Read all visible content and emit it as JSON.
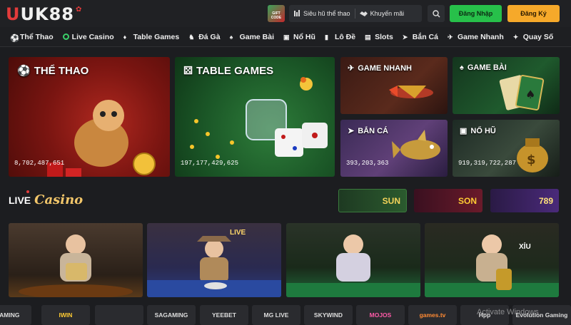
{
  "header": {
    "logo_text": "UK88",
    "gift_label": "GIFT CODE",
    "top_links": [
      {
        "label": "Siêu hũ thể thao",
        "icon": "sliders-icon"
      },
      {
        "label": "Khuyến mãi",
        "icon": "handshake-icon"
      }
    ],
    "login_label": "Đăng Nhập",
    "register_label": "Đăng Ký"
  },
  "nav": [
    {
      "label": "Thể Thao",
      "icon": "sports-icon"
    },
    {
      "label": "Live Casino",
      "icon": "casino-chip-icon"
    },
    {
      "label": "Table Games",
      "icon": "table-games-icon"
    },
    {
      "label": "Đá Gà",
      "icon": "rooster-icon"
    },
    {
      "label": "Game Bài",
      "icon": "cards-icon"
    },
    {
      "label": "Nổ Hũ",
      "icon": "jar-icon"
    },
    {
      "label": "Lô Đề",
      "icon": "lottery-icon"
    },
    {
      "label": "Slots",
      "icon": "slot-machine-icon"
    },
    {
      "label": "Bắn Cá",
      "icon": "fish-icon"
    },
    {
      "label": "Game Nhanh",
      "icon": "rocket-icon"
    },
    {
      "label": "Quay Số",
      "icon": "wheel-icon"
    }
  ],
  "tiles": {
    "thethao": {
      "title": "THỂ THAO",
      "count": "8,702,487,651"
    },
    "table": {
      "title": "TABLE GAMES",
      "count": "197,177,429,625"
    },
    "nhanh": {
      "title": "GAME NHANH"
    },
    "bai": {
      "title": "GAME BÀI"
    },
    "ca": {
      "title": "BẮN CÁ",
      "count": "393,203,363"
    },
    "hu": {
      "title": "NỔ HŨ",
      "count": "919,319,722,287"
    }
  },
  "live": {
    "title_prefix": "LIVE",
    "title_script": "Casino",
    "brands": [
      "SUN",
      "SON",
      "789"
    ],
    "game_labels": [
      "LIVE",
      "XỈU"
    ]
  },
  "providers": [
    "GAMING",
    "IWIN",
    "",
    "SAGAMING",
    "YEEBET",
    "MG LIVE",
    "SKYWIND",
    "MOJOS",
    "games.tv",
    "Hpp",
    "Evolution Gaming"
  ],
  "watermark": "Activate Windows",
  "colors": {
    "login_bg": "#27c04a",
    "register_bg": "#f6a92a",
    "accent_red": "#e23b3b",
    "casino_gold": "#f2c66a"
  }
}
